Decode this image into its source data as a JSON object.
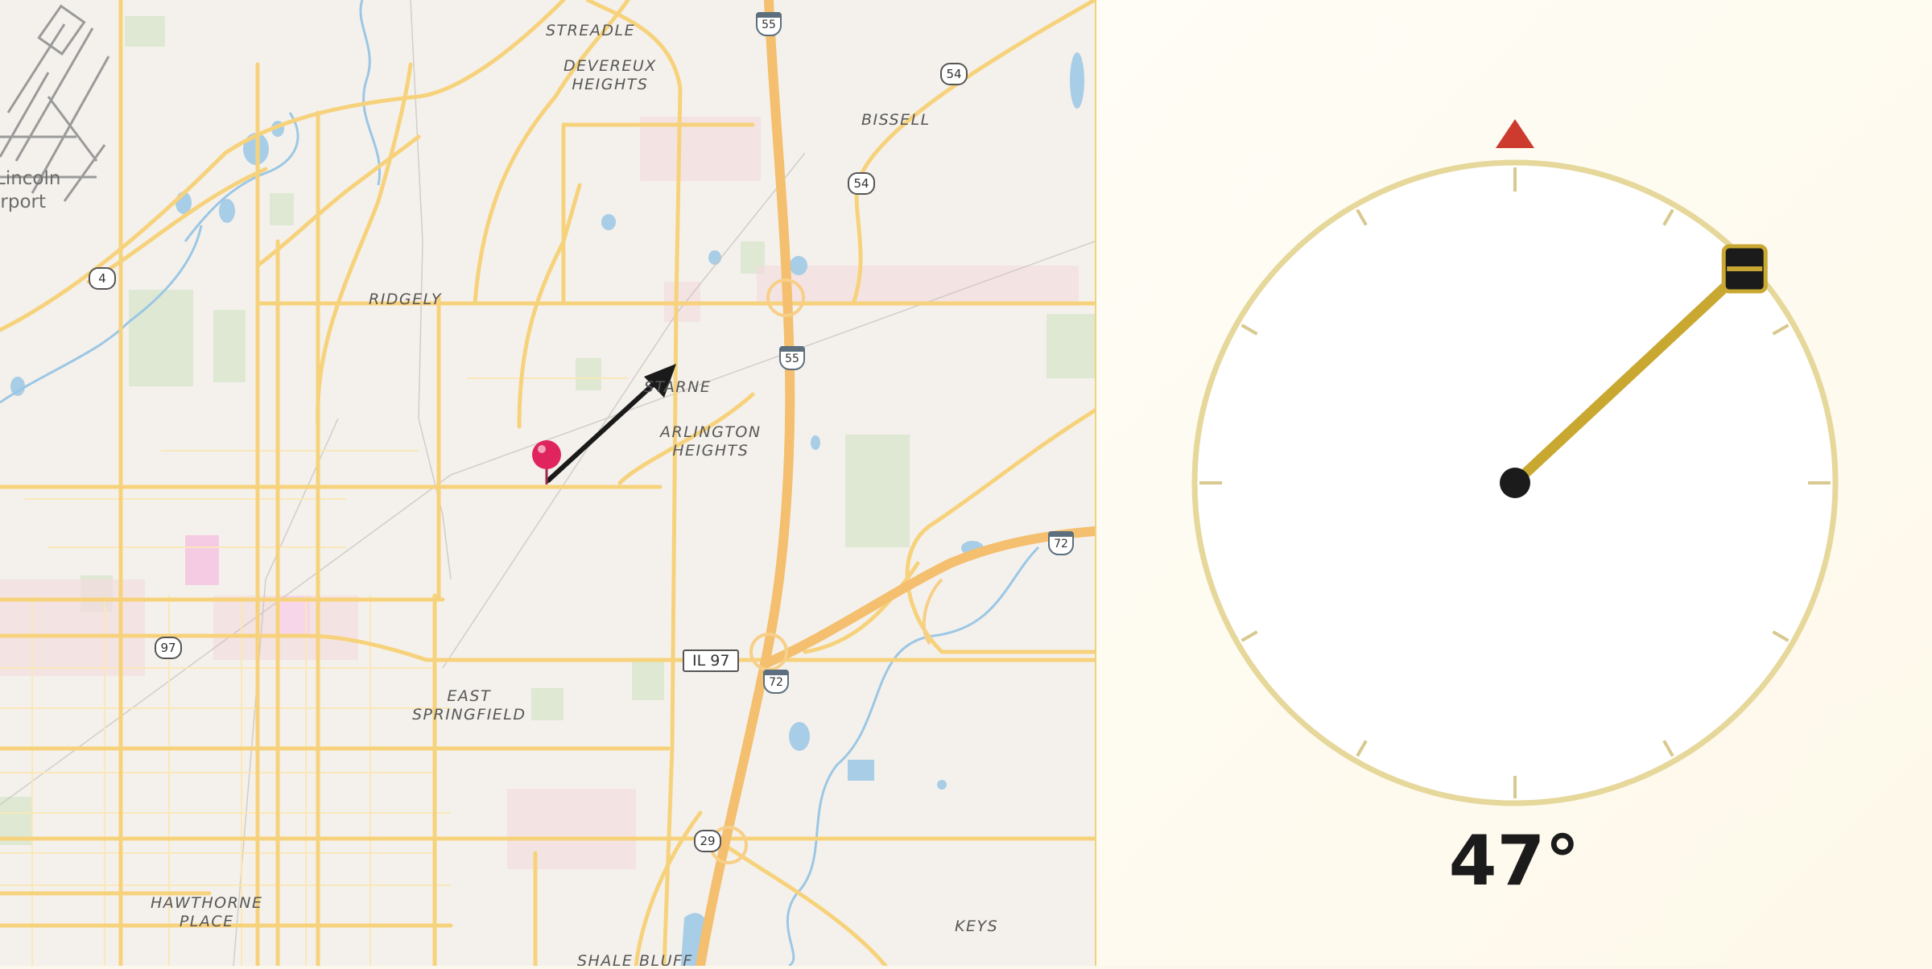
{
  "map": {
    "places": [
      {
        "id": "streadle",
        "label": "STREADLE"
      },
      {
        "id": "devereux",
        "label": "DEVEREUX\nHEIGHTS"
      },
      {
        "id": "bissell",
        "label": "BISSELL"
      },
      {
        "id": "ridgely",
        "label": "RIDGELY"
      },
      {
        "id": "starne",
        "label": "STARNE"
      },
      {
        "id": "arlington",
        "label": "ARLINGTON\nHEIGHTS"
      },
      {
        "id": "east-springfield",
        "label": "EAST\nSPRINGFIELD"
      },
      {
        "id": "hawthorne",
        "label": "HAWTHORNE\nPLACE"
      },
      {
        "id": "keys",
        "label": "KEYS"
      },
      {
        "id": "shale-bluff",
        "label": "SHALE BLUFF"
      }
    ],
    "poi_label": "Lincoln\nirport",
    "shields": {
      "i55_top": "55",
      "i55_mid": "55",
      "i72_right": "72",
      "i72_mid": "72",
      "us54_top": "54",
      "us54_mid": "54",
      "rt4": "4",
      "rt97": "97",
      "rt29": "29",
      "il97": "IL 97"
    },
    "marker": {
      "icon": "map-pin-icon",
      "color": "#e0245e"
    },
    "arrow_color": "#1a1a1a"
  },
  "compass": {
    "heading_deg": 47,
    "heading_label": "47°",
    "north_marker_color": "#cc3b2e",
    "needle_color": "#c9a832",
    "hub_color": "#1b1b1b",
    "ring_color": "#e6d79a"
  }
}
